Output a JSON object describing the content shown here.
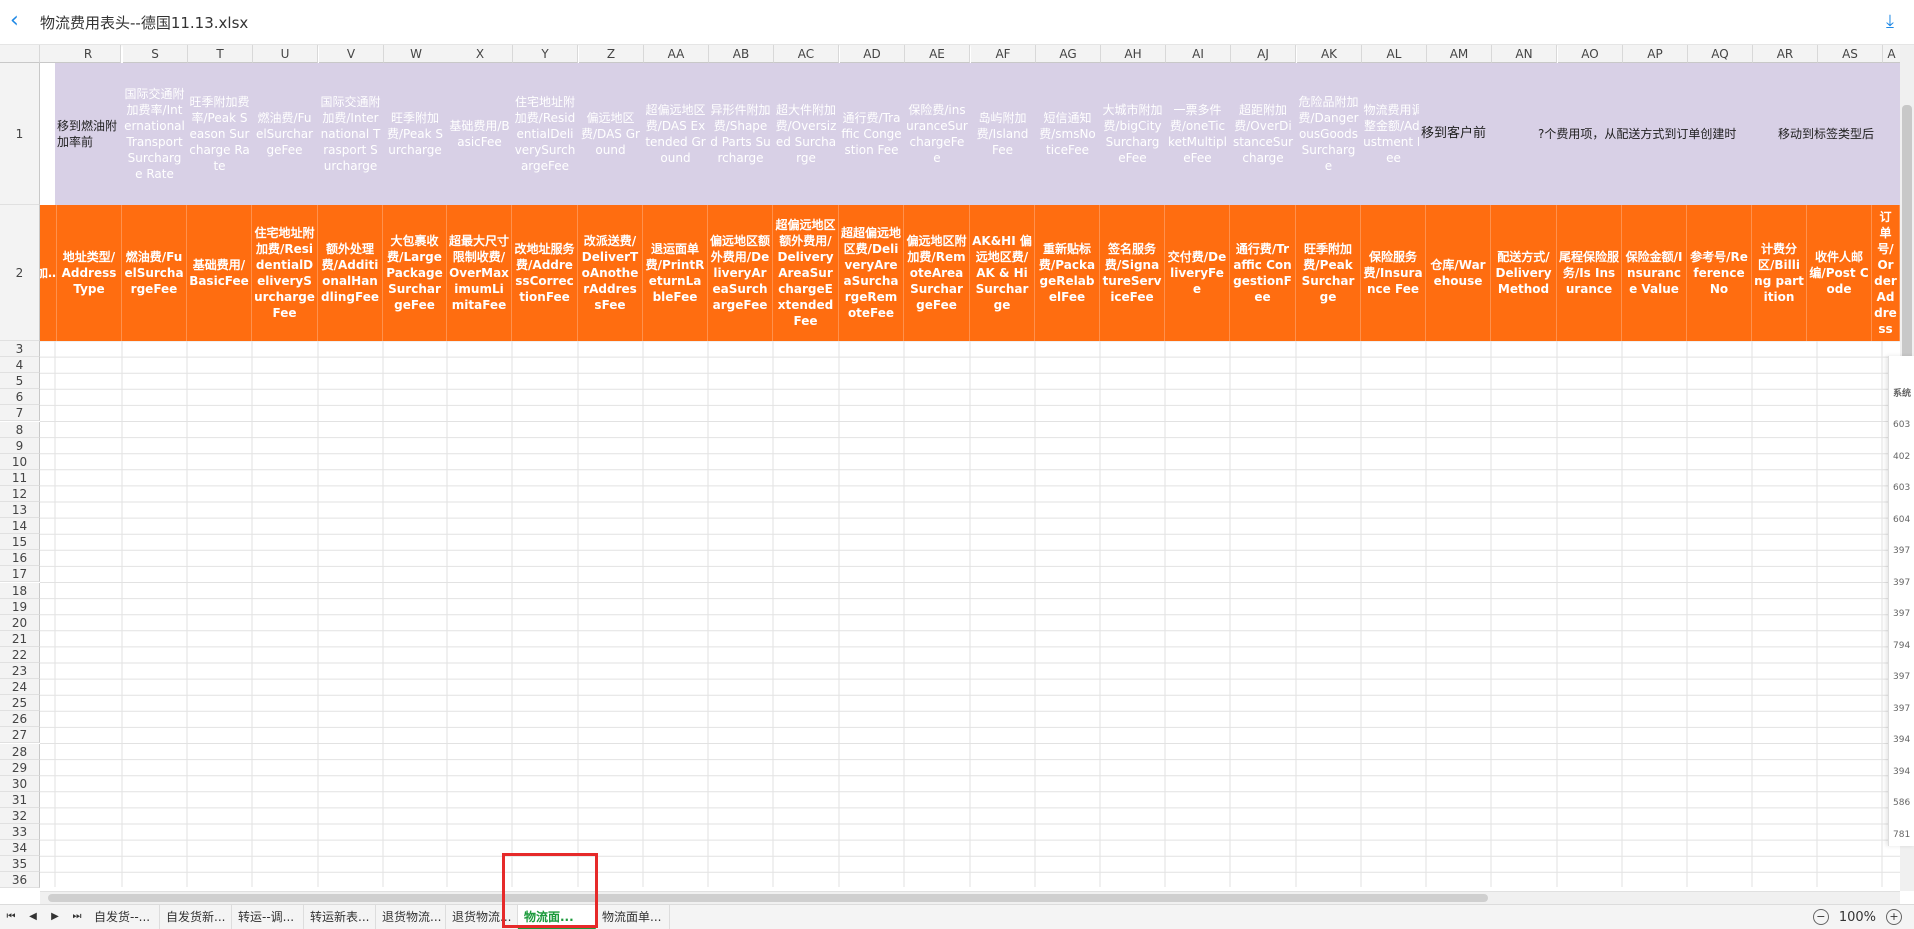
{
  "window": {
    "title": "物流费用表头--德国11.13.xlsx"
  },
  "columns": [
    "R",
    "S",
    "T",
    "U",
    "V",
    "W",
    "X",
    "Y",
    "Z",
    "AA",
    "AB",
    "AC",
    "AD",
    "AE",
    "AF",
    "AG",
    "AH",
    "AI",
    "AJ",
    "AK",
    "AL",
    "AM",
    "AN",
    "AO",
    "AP",
    "AQ",
    "AR",
    "AS",
    "A"
  ],
  "row1": [
    "移到燃油附加率前",
    "国际交通附加费率/International Transport Surcharge Rate",
    "旺季附加费率/Peak Season Surcharge Rate",
    "燃油费/FuelSurchargeFee",
    "国际交通附加费/International Trasport Surcharge",
    "旺季附加费/Peak Surcharge",
    "基础费用/BasicFee",
    "住宅地址附加费/ResidentialDeliverySurchargeFee",
    "偏远地区费/DAS Ground",
    "超偏远地区费/DAS Extended Ground",
    "异形件附加费/Shaped Parts Surcharge",
    "超大件附加费/Oversized Surcharge",
    "通行费/Traffic Congestion Fee",
    "保险费/insuranceSurchargeFee",
    "岛屿附加费/Island Fee",
    "短信通知费/smsNoticeFee",
    "大城市附加费/bigCitySurchargeFee",
    "一票多件费/oneTicketMultipleFee",
    "超距附加费/OverDistanceSurcharge",
    "危险品附加费/DangerousGoodsSurcharge",
    "物流费用调整金额/Adjustment Fee",
    "移到客户前",
    "?个费用项，从配送方式到订单创建时间",
    "移动到标签类型后"
  ],
  "row2": [
    "加…",
    "地址类型/Address Type",
    "燃油费/FuelSurchargeFee",
    "基础费用/BasicFee",
    "住宅地址附加费/ResidentialDeliverySurchargeFee",
    "额外处理费/AdditionalHandlingFee",
    "大包裹收费/LargePackageSurchargeFee",
    "超最大尺寸限制收费/OverMaximumLimitaFee",
    "改地址服务费/AddressCorrectionFee",
    "改派送费/DeliverToAnotherAddressFee",
    "退运面单费/PrintReturnLableFee",
    "偏远地区额外费用/DeliveryAreaSurchargeFee",
    "超偏远地区额外费用/DeliveryAreaSurchargeExtendedFee",
    "超超偏远地区费/DeliveryAreaSurchargeRemoteFee",
    "偏远地区附加费/RemoteAreaSurchargeFee",
    "AK&HI 偏远地区费/AK & Hi Surcharge",
    "重新贴标费/PackageRelabelFee",
    "签名服务费/SignatureServiceFee",
    "交付费/DeliveryFee",
    "通行费/Traffic CongestionFee",
    "旺季附加费/Peak Surcharge",
    "保险服务费/Insurance Fee",
    "仓库/Warehouse",
    "配送方式/Delivery Method",
    "尾程保险服务/Is Insurance",
    "保险金额/Insurance Value",
    "参考号/Reference No",
    "计费分区/Billing partition",
    "收件人邮编/Post Code",
    "订单号/Order Address"
  ],
  "row_numbers": [
    "1",
    "2",
    "3",
    "4",
    "5",
    "6",
    "7",
    "8",
    "9",
    "10",
    "11",
    "12",
    "13",
    "14",
    "15",
    "16",
    "17",
    "18",
    "19",
    "20",
    "21",
    "22",
    "23",
    "24",
    "25",
    "26",
    "27",
    "28",
    "29",
    "30",
    "31",
    "32",
    "33",
    "34",
    "35",
    "36"
  ],
  "sheet_tabs": [
    "自发货--...",
    "自发货新...",
    "转运--调...",
    "转运新表...",
    "退货物流...",
    "退货物流...",
    "物流面...",
    "物流面单..."
  ],
  "active_tab_index": 6,
  "zoom": "100%",
  "side_panel": {
    "header": "系统",
    "values": [
      "603",
      "402",
      "603",
      "604",
      "397",
      "397",
      "397",
      "794",
      "397",
      "397",
      "394",
      "394",
      "586",
      "781"
    ]
  },
  "colors": {
    "row1_bg": "#d8d0e6",
    "row2_bg": "#ff6d10",
    "active_tab": "#1b9a3b",
    "highlight": "#e62a2a"
  }
}
